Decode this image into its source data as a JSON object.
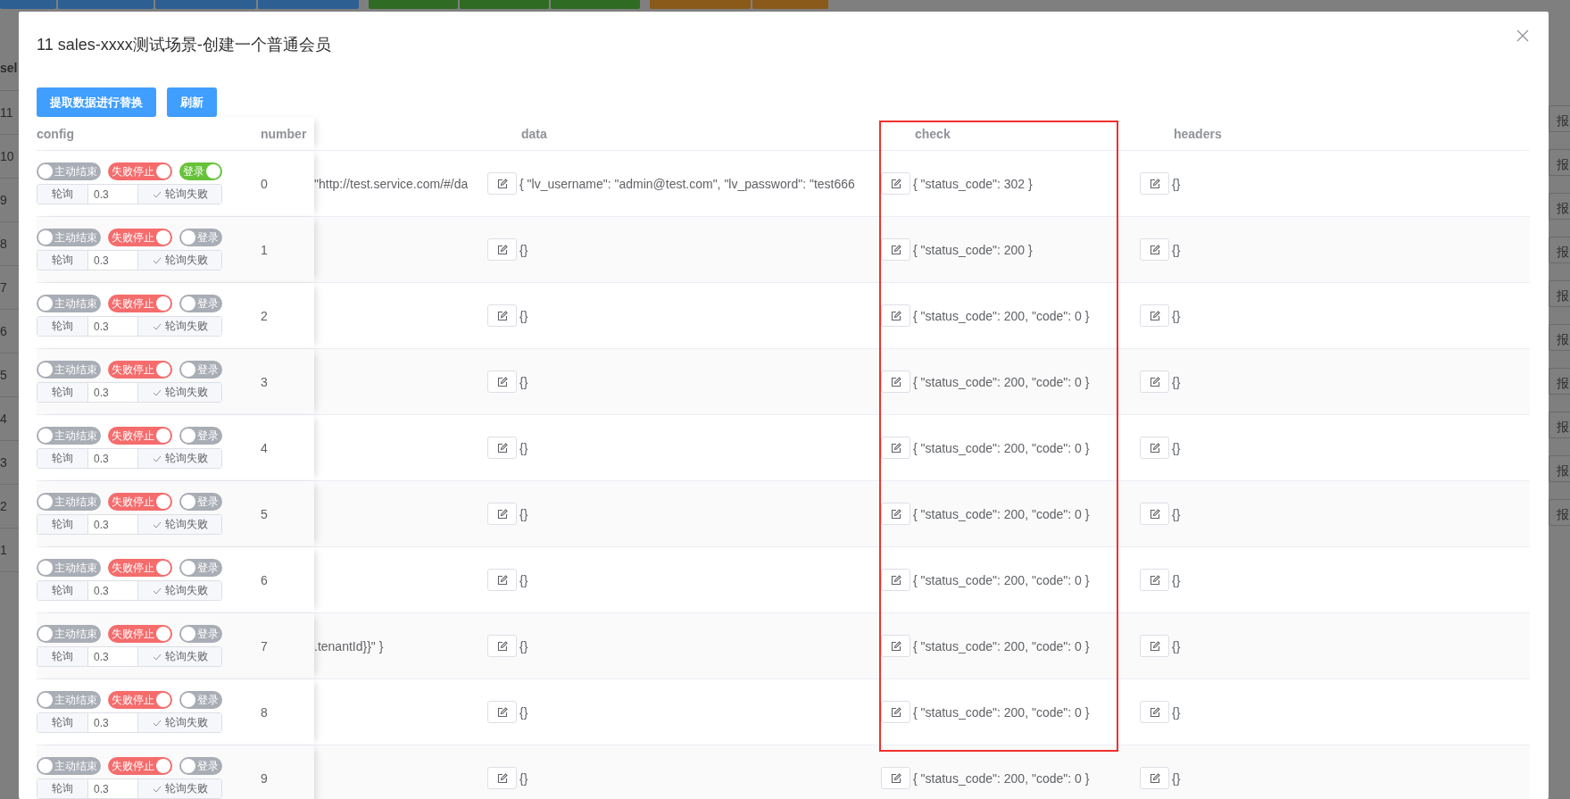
{
  "backdrop": {
    "header_fragment": "sel",
    "row_numbers": [
      "11",
      "10",
      "9",
      "8",
      "7",
      "6",
      "5",
      "4",
      "3",
      "2",
      "1"
    ],
    "action_labels": [
      "报",
      "报",
      "报",
      "报",
      "报",
      "报",
      "报",
      "报",
      "报",
      "报"
    ]
  },
  "dialog": {
    "title": "11 sales-xxxx测试场景-创建一个普通会员",
    "buttons": [
      "提取数据进行替换",
      "刷新"
    ],
    "table": {
      "columns": [
        "config",
        "number",
        "data",
        "check",
        "headers"
      ],
      "rows": [
        {
          "switches": [
            {
              "label": "主动结束",
              "on": false
            },
            {
              "label": "失败停止",
              "on": true
            },
            {
              "label": "登录",
              "on": true
            }
          ],
          "poll": {
            "label": "轮询",
            "value": "0.3",
            "option": "轮询失败"
          },
          "number": "0",
          "url": "\"http://test.service.com/#/da",
          "data": "{ \"lv_username\": \"admin@test.com\", \"lv_password\": \"test666",
          "check": "{ \"status_code\": 302 }",
          "headers": "{}"
        },
        {
          "switches": [
            {
              "label": "主动结束",
              "on": false
            },
            {
              "label": "失败停止",
              "on": true
            },
            {
              "label": "登录",
              "on": false
            }
          ],
          "poll": {
            "label": "轮询",
            "value": "0.3",
            "option": "轮询失败"
          },
          "number": "1",
          "data": "{}",
          "check": "{ \"status_code\": 200 }",
          "headers": "{}"
        },
        {
          "switches": [
            {
              "label": "主动结束",
              "on": false
            },
            {
              "label": "失败停止",
              "on": true
            },
            {
              "label": "登录",
              "on": false
            }
          ],
          "poll": {
            "label": "轮询",
            "value": "0.3",
            "option": "轮询失败"
          },
          "number": "2",
          "data": "{}",
          "check": "{ \"status_code\": 200, \"code\": 0 }",
          "headers": "{}"
        },
        {
          "switches": [
            {
              "label": "主动结束",
              "on": false
            },
            {
              "label": "失败停止",
              "on": true
            },
            {
              "label": "登录",
              "on": false
            }
          ],
          "poll": {
            "label": "轮询",
            "value": "0.3",
            "option": "轮询失败"
          },
          "number": "3",
          "data": "{}",
          "check": "{ \"status_code\": 200, \"code\": 0 }",
          "headers": "{}"
        },
        {
          "switches": [
            {
              "label": "主动结束",
              "on": false
            },
            {
              "label": "失败停止",
              "on": true
            },
            {
              "label": "登录",
              "on": false
            }
          ],
          "poll": {
            "label": "轮询",
            "value": "0.3",
            "option": "轮询失败"
          },
          "number": "4",
          "data": "{}",
          "check": "{ \"status_code\": 200, \"code\": 0 }",
          "headers": "{}"
        },
        {
          "switches": [
            {
              "label": "主动结束",
              "on": false
            },
            {
              "label": "失败停止",
              "on": true
            },
            {
              "label": "登录",
              "on": false
            }
          ],
          "poll": {
            "label": "轮询",
            "value": "0.3",
            "option": "轮询失败"
          },
          "number": "5",
          "data": "{}",
          "check": "{ \"status_code\": 200, \"code\": 0 }",
          "headers": "{}"
        },
        {
          "switches": [
            {
              "label": "主动结束",
              "on": false
            },
            {
              "label": "失败停止",
              "on": true
            },
            {
              "label": "登录",
              "on": false
            }
          ],
          "poll": {
            "label": "轮询",
            "value": "0.3",
            "option": "轮询失败"
          },
          "number": "6",
          "data": "{}",
          "check": "{ \"status_code\": 200, \"code\": 0 }",
          "headers": "{}"
        },
        {
          "switches": [
            {
              "label": "主动结束",
              "on": false
            },
            {
              "label": "失败停止",
              "on": true
            },
            {
              "label": "登录",
              "on": false
            }
          ],
          "poll": {
            "label": "轮询",
            "value": "0.3",
            "option": "轮询失败"
          },
          "number": "7",
          "url": ".tenantId}}\" }",
          "data": "{}",
          "check": "{ \"status_code\": 200, \"code\": 0 }",
          "headers": "{}"
        },
        {
          "switches": [
            {
              "label": "主动结束",
              "on": false
            },
            {
              "label": "失败停止",
              "on": true
            },
            {
              "label": "登录",
              "on": false
            }
          ],
          "poll": {
            "label": "轮询",
            "value": "0.3",
            "option": "轮询失败"
          },
          "number": "8",
          "data": "{}",
          "check": "{ \"status_code\": 200, \"code\": 0 }",
          "headers": "{}"
        },
        {
          "switches": [
            {
              "label": "主动结束",
              "on": false
            },
            {
              "label": "失败停止",
              "on": true
            },
            {
              "label": "登录",
              "on": false
            }
          ],
          "poll": {
            "label": "轮询",
            "value": "0.3",
            "option": "轮询失败"
          },
          "number": "9",
          "data": "{}",
          "check": "{ \"status_code\": 200, \"code\": 0 }",
          "headers": "{}"
        }
      ]
    }
  }
}
